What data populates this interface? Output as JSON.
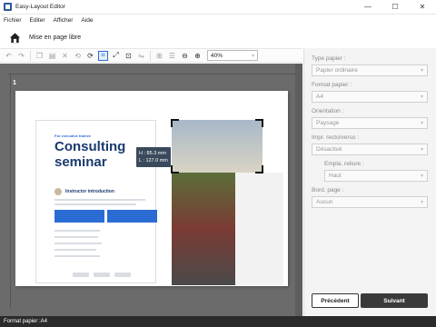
{
  "window": {
    "title": "Easy-Layout Editor",
    "minimize": "—",
    "maximize": "☐",
    "close": "✕"
  },
  "menu": [
    "Fichier",
    "Editer",
    "Afficher",
    "Aide"
  ],
  "header": {
    "title": "Mise en page libre"
  },
  "toolbar": {
    "zoom": "40%"
  },
  "canvas": {
    "page_number": "1",
    "brochure": {
      "tag": "For executive trainee",
      "title": "Consulting seminar",
      "instructor": "Instructor introduction"
    },
    "tooltip": {
      "h": "H : 85.3 mm",
      "l": "L : 127.0 mm"
    }
  },
  "panel": {
    "paper_type_label": "Type papier :",
    "paper_type_value": "Papier ordinaire",
    "paper_size_label": "Format papier :",
    "paper_size_value": "A4",
    "orientation_label": "Orientation :",
    "orientation_value": "Paysage",
    "duplex_label": "Impr. recto/verso :",
    "duplex_value": "Désactivé",
    "binding_label": "Empla. reliure :",
    "binding_value": "Haut",
    "border_label": "Bord. page :",
    "border_value": "Aucun",
    "prev_button": "Précédent",
    "next_button": "Suivant"
  },
  "status": {
    "text": "Format papier :A4"
  },
  "colors": {
    "accent": "#2b6cd4",
    "status_bar": "#2b2b2b",
    "next_button": "#3a3a3a"
  }
}
